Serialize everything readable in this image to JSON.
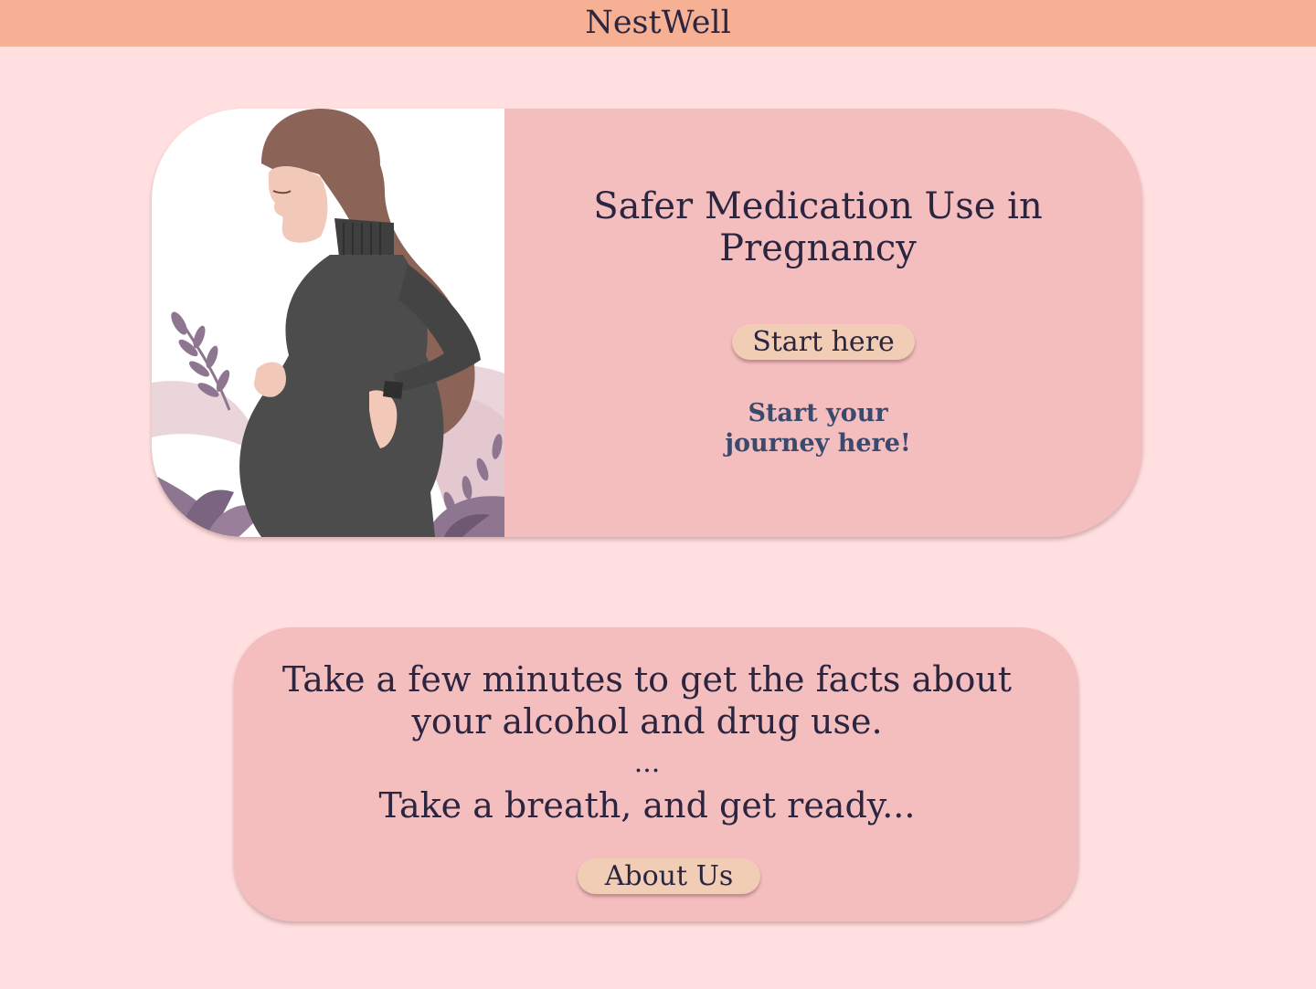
{
  "header": {
    "brand": "NestWell"
  },
  "hero": {
    "title": "Safer Medication Use in Pregnancy",
    "start_button": "Start here",
    "subtitle_line1": "Start your",
    "subtitle_line2": "journey here!"
  },
  "info": {
    "line1": "Take a few minutes to get the facts about",
    "line2": "your alcohol and drug use.",
    "ellipsis": "...",
    "line3": "Take a breath, and get ready...",
    "about_button": "About Us"
  },
  "colors": {
    "page_background": "#ffdfe0",
    "header_background": "#f6b094",
    "card_background": "#f4bdbe",
    "button_background": "#f2cdb5",
    "text_dark": "#2b2540",
    "subtitle_blue": "#3a4a6e"
  }
}
